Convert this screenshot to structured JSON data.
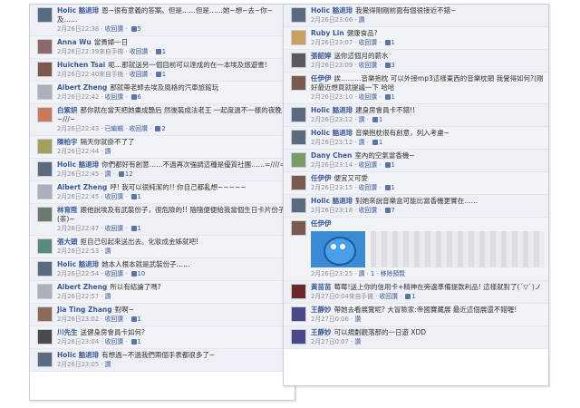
{
  "colors": {
    "author": "#3b5998",
    "meta": "#8a8f9c",
    "accent": "#5b74a8"
  },
  "left": [
    {
      "author": "Holic 豁退琲",
      "text": "恩~很有意義的答案。但是……但是……她~想~去~你~及……",
      "time": "2月26日22:38",
      "actions": [
        "收回讚"
      ],
      "likes": "5",
      "avatar": "#5a6b80"
    },
    {
      "author": "Anna Wu",
      "text": "當貴婦一日",
      "time": "2月26日22:39來自手機",
      "actions": [
        "收回讚"
      ],
      "likes": "1",
      "avatar": "#8a6b6a"
    },
    {
      "author": "Huichen Tsai",
      "text": "呃…那就送另一個目前可以達成的在一本埃及旅遊書!",
      "time": "2月26日22:40來自手機",
      "actions": [
        "收回讚"
      ],
      "likes": "1",
      "avatar": "#7c5a4a"
    },
    {
      "author": "Albert Zheng",
      "text": "那就帶老師去埃及風格的汽車旅館玩",
      "time": "2月26日22:42",
      "actions": [
        "收回讚"
      ],
      "likes": "6",
      "avatar": "#aab0bb"
    },
    {
      "author": "白紫妍",
      "text": "那你就在當天把她畫成艷后 然後裝成法老王 一起度過不一樣的夜晚~///~",
      "time": "2月26日22:43",
      "actions": [
        "已編輯",
        "收回讚"
      ],
      "likes": "2",
      "avatar": "#c97a5a"
    },
    {
      "author": "陳柏宇",
      "text": "隔天你就掛不了了",
      "time": "2月26日22:44",
      "actions": [
        "讚"
      ],
      "likes": "",
      "avatar": "#a0a060"
    },
    {
      "author": "Holic 豁退琲",
      "text": "你們都好有創意……不過再次強調這種是優質社團……=////=",
      "time": "2月26日22:45",
      "actions": [
        "讚"
      ],
      "likes": "12",
      "avatar": "#5a6b80"
    },
    {
      "author": "Albert Zheng",
      "text": "呼! 我可以很純潔的!! 你自己都亂想~~~~~",
      "time": "2月26日22:45",
      "actions": [
        "收回讚"
      ],
      "likes": "1",
      "avatar": "#aab0bb"
    },
    {
      "author": "林育陞",
      "text": "跟他說埃及有武裝份子，很危險的!! 隨隨便便給我當個生日卡片份子 (茶)~",
      "time": "2月26日22:47",
      "actions": [
        "收回讚"
      ],
      "likes": "1",
      "avatar": "#6b7b6b"
    },
    {
      "author": "張大頭",
      "text": "拒自己包起來送出去。化妝成金姊就吧!",
      "time": "2月26日22:53",
      "actions": [
        "讚"
      ],
      "likes": "",
      "avatar": "#5a8a7a"
    },
    {
      "author": "Holic 豁退琲",
      "text": "她本人根本就是武裝份子……",
      "time": "2月26日22:54",
      "actions": [
        "收回讚"
      ],
      "likes": "10",
      "avatar": "#5a6b80"
    },
    {
      "author": "Albert Zheng",
      "text": "所以有結論了嗎?",
      "time": "2月26日22:57",
      "actions": [
        "讚"
      ],
      "likes": "",
      "avatar": "#aab0bb"
    },
    {
      "author": "Jia Ting Zhang",
      "text": "對啊~",
      "time": "2月26日23:02",
      "actions": [
        "收回讚"
      ],
      "likes": "1",
      "avatar": "#8a6a5a"
    },
    {
      "author": "川先生",
      "text": "送健身房會員卡如何?",
      "time": "2月26日23:04",
      "actions": [
        "收回讚"
      ],
      "likes": "1",
      "avatar": "#4a4a4a"
    },
    {
      "author": "Holic 豁退琲",
      "text": "有想過~不過我們兩個手表都很多了~",
      "time": "2月26日23:05",
      "actions": [
        "讚"
      ],
      "likes": "",
      "avatar": "#5a6b80"
    }
  ],
  "right": [
    {
      "author": "Holic 豁退琲",
      "text": "我覺得剛剛前面有個很接近不錯~",
      "time": "2月26日23:06",
      "actions": [
        "讚"
      ],
      "likes": "",
      "avatar": "#5a6b80"
    },
    {
      "author": "Ruby Lin",
      "text": "健康食品?",
      "time": "2月26日23:07",
      "actions": [
        "收回讚"
      ],
      "likes": "1",
      "avatar": "#c8a060"
    },
    {
      "author": "張韶婷",
      "text": "送你這個月的薪水",
      "time": "2月26日23:09",
      "actions": [
        "收回讚"
      ],
      "likes": "3",
      "avatar": "#5a5a5a"
    },
    {
      "author": "任伊伊",
      "text": "誒………音樂抱枕 可以外接mp3這樣東西的音樂枕頭 我覺得如何?(剛好最近想買就提議一下 哈哈",
      "time": "2月26日23:10",
      "actions": [
        "收回讚"
      ],
      "likes": "1",
      "avatar": "#7a5a50"
    },
    {
      "author": "Holic 豁退琲",
      "text": "建身房會員卡不錯!!",
      "time": "2月26日23:12",
      "actions": [
        "讚"
      ],
      "likes": "1",
      "avatar": "#5a6b80"
    },
    {
      "author": "Holic 豁退琲",
      "text": "音樂抱枕很有創意，列入考慮~",
      "time": "2月26日23:12",
      "actions": [
        "讚"
      ],
      "likes": "1",
      "avatar": "#5a6b80"
    },
    {
      "author": "Dany Chen",
      "text": "室內的空氣當香機~",
      "time": "2月26日23:14",
      "actions": [
        "收回讚"
      ],
      "likes": "1",
      "avatar": "#7a9a6a"
    },
    {
      "author": "任伊伊",
      "text": "便宜又可愛",
      "time": "2月26日23:15",
      "actions": [
        "收回讚"
      ],
      "likes": "1",
      "avatar": "#7a5a50"
    },
    {
      "author": "Holic 豁退琲",
      "text": "對她來說音樂盒可能比當香機更實在……",
      "time": "2月26日23:18",
      "actions": [
        "收回讚"
      ],
      "likes": "7",
      "avatar": "#5a6b80"
    },
    {
      "author": "任伊伊",
      "text": "",
      "time": "2月26日23:25",
      "actions": [
        "讚",
        "1",
        "移除預覽"
      ],
      "likes": "",
      "avatar": "#7a5a50",
      "attachment": true
    },
    {
      "author": "黃苗苗",
      "text": "莓莓!送上你的信用卡+精神在旁邊準備提款利品! 這樣就對了(´▽`)ノ",
      "time": "2月27日0:04來自手機",
      "actions": [
        "收回讚"
      ],
      "likes": "1",
      "avatar": "#6a2a2a"
    },
    {
      "author": "王靜妙",
      "text": "帶她去看展覽呢? 大冒險家:帝國寶藏展 最近這個展還不錯喔!",
      "time": "2月27日0:06",
      "actions": [
        "讚"
      ],
      "likes": "",
      "avatar": "#4a4a8a"
    },
    {
      "author": "王靜妙",
      "text": "可以規劃觀落那的一日遊 XDD",
      "time": "2月27日0:07",
      "actions": [
        "讚"
      ],
      "likes": "",
      "avatar": "#4a4a8a"
    }
  ]
}
